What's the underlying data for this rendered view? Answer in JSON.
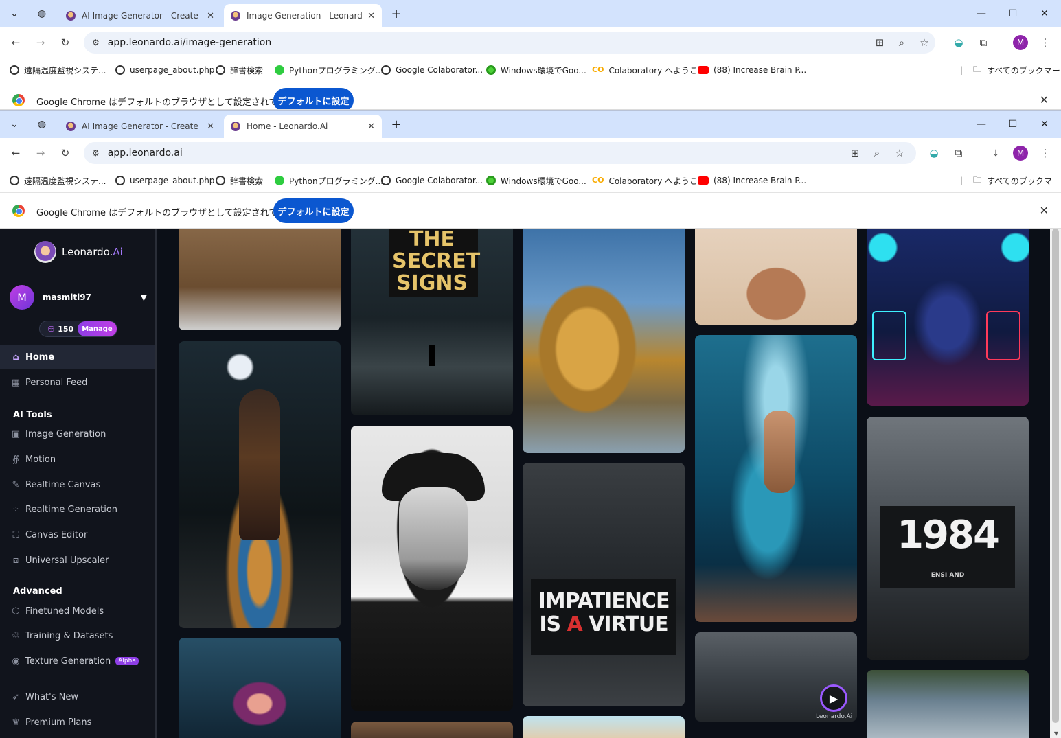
{
  "back_window": {
    "tabs": [
      {
        "title": "AI Image Generator - Create Ar"
      },
      {
        "title": "Image Generation - Leonardo.A"
      }
    ],
    "url": "app.leonardo.ai/image-generation"
  },
  "front_window": {
    "tabs": [
      {
        "title": "AI Image Generator - Create Ar"
      },
      {
        "title": "Home - Leonardo.Ai"
      }
    ],
    "url": "app.leonardo.ai"
  },
  "bookmarks": [
    {
      "label": "遠隔温度監視システ...",
      "icon": "globe-icon"
    },
    {
      "label": "userpage_about.php",
      "icon": "globe-icon"
    },
    {
      "label": "辞書検索",
      "icon": "globe-icon"
    },
    {
      "label": "Pythonプログラミング...",
      "icon": "green-circle-icon"
    },
    {
      "label": "Google Colaborator...",
      "icon": "globe-icon"
    },
    {
      "label": "Windows環境でGoo...",
      "icon": "green-ring-icon"
    },
    {
      "label": "Colaboratory へようこ...",
      "icon": "colab-icon"
    },
    {
      "label": "(88) Increase Brain P...",
      "icon": "youtube-icon"
    }
  ],
  "all_bookmarks": "すべてのブックマーク",
  "all_bookmarks_front": "すべてのブックマーク",
  "infobar": {
    "message": "Google Chrome はデフォルトのブラウザとして設定されていません",
    "button": "デフォルトに設定"
  },
  "profile_initial": "M",
  "app": {
    "brand": "Leonardo.",
    "brand_ai": "Ai",
    "user": {
      "initial": "M",
      "name": "masmiti97"
    },
    "credits": "150",
    "manage": "Manage",
    "nav_top": [
      {
        "label": "Home",
        "icon": "home-icon",
        "active": true
      },
      {
        "label": "Personal Feed",
        "icon": "grid-icon"
      }
    ],
    "section_tools": "AI Tools",
    "tools": [
      {
        "label": "Image Generation",
        "icon": "image-icon"
      },
      {
        "label": "Motion",
        "icon": "motion-icon"
      },
      {
        "label": "Realtime Canvas",
        "icon": "brush-icon"
      },
      {
        "label": "Realtime Generation",
        "icon": "dots-icon"
      },
      {
        "label": "Canvas Editor",
        "icon": "canvas-icon"
      },
      {
        "label": "Universal Upscaler",
        "icon": "upscale-icon"
      }
    ],
    "section_advanced": "Advanced",
    "advanced": [
      {
        "label": "Finetuned Models",
        "icon": "cube-icon"
      },
      {
        "label": "Training & Datasets",
        "icon": "training-icon"
      },
      {
        "label": "Texture Generation",
        "icon": "texture-icon",
        "badge": "Alpha"
      }
    ],
    "bottom": [
      {
        "label": "What's New",
        "icon": "rocket-icon"
      },
      {
        "label": "Premium Plans",
        "icon": "crown-icon"
      }
    ],
    "gallery_text": {
      "secret_signs": "THE SECRET SIGNS",
      "impatience_1": "IMPATIENCE",
      "impatience_2a": "IS ",
      "impatience_2b": "A",
      "impatience_2c": " VIRTUE",
      "year": "1984",
      "ensi": "ENSI AND",
      "watermark": "Leonardo.Ai"
    }
  }
}
